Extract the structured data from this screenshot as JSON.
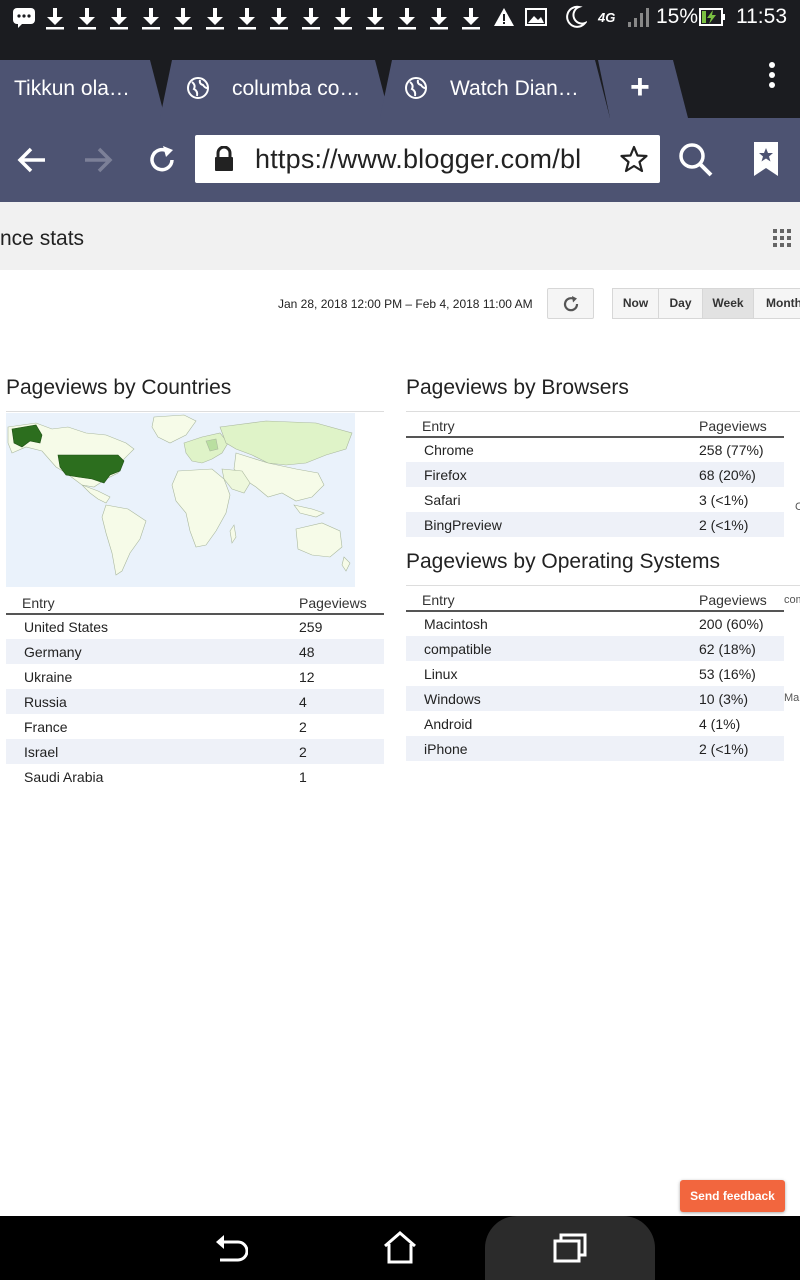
{
  "status_bar": {
    "battery": "15%",
    "time": "11:53",
    "network": "4G"
  },
  "tabs": [
    {
      "title": "Tikkun ola…",
      "active": false
    },
    {
      "title": "columba co…",
      "active": false
    },
    {
      "title": "Watch Dian…",
      "active": false
    }
  ],
  "new_tab_label": "+",
  "toolbar": {
    "url": "https://www.blogger.com/bl"
  },
  "page": {
    "title": "nce stats",
    "date_range": "Jan 28, 2018 12:00 PM – Feb 4, 2018 11:00 AM",
    "periods": [
      "Now",
      "Day",
      "Week",
      "Month"
    ],
    "active_period": "Week"
  },
  "countries": {
    "heading": "Pageviews by Countries",
    "columns": [
      "Entry",
      "Pageviews"
    ],
    "rows": [
      {
        "entry": "United States",
        "value": "259"
      },
      {
        "entry": "Germany",
        "value": "48"
      },
      {
        "entry": "Ukraine",
        "value": "12"
      },
      {
        "entry": "Russia",
        "value": "4"
      },
      {
        "entry": "France",
        "value": "2"
      },
      {
        "entry": "Israel",
        "value": "2"
      },
      {
        "entry": "Saudi Arabia",
        "value": "1"
      }
    ]
  },
  "browsers": {
    "heading": "Pageviews by Browsers",
    "columns": [
      "Entry",
      "Pageviews"
    ],
    "rows": [
      {
        "entry": "Chrome",
        "value": "258 (77%)"
      },
      {
        "entry": "Firefox",
        "value": "68 (20%)"
      },
      {
        "entry": "Safari",
        "value": "3 (<1%)"
      },
      {
        "entry": "BingPreview",
        "value": "2 (<1%)"
      }
    ]
  },
  "os": {
    "heading": "Pageviews by Operating Systems",
    "columns": [
      "Entry",
      "Pageviews"
    ],
    "rows": [
      {
        "entry": "Macintosh",
        "value": "200 (60%)"
      },
      {
        "entry": "compatible",
        "value": "62 (18%)"
      },
      {
        "entry": "Linux",
        "value": "53 (16%)"
      },
      {
        "entry": "Windows",
        "value": "10 (3%)"
      },
      {
        "entry": "Android",
        "value": "4 (1%)"
      },
      {
        "entry": "iPhone",
        "value": "2 (<1%)"
      }
    ]
  },
  "clipped_right": [
    "C",
    "com",
    "Ma"
  ],
  "feedback_label": "Send feedback",
  "colors": {
    "toolbar": "#4d5372",
    "status_bar": "#1b1c20",
    "map_highlight": "#2c6e1e",
    "feedback": "#f2663e"
  }
}
